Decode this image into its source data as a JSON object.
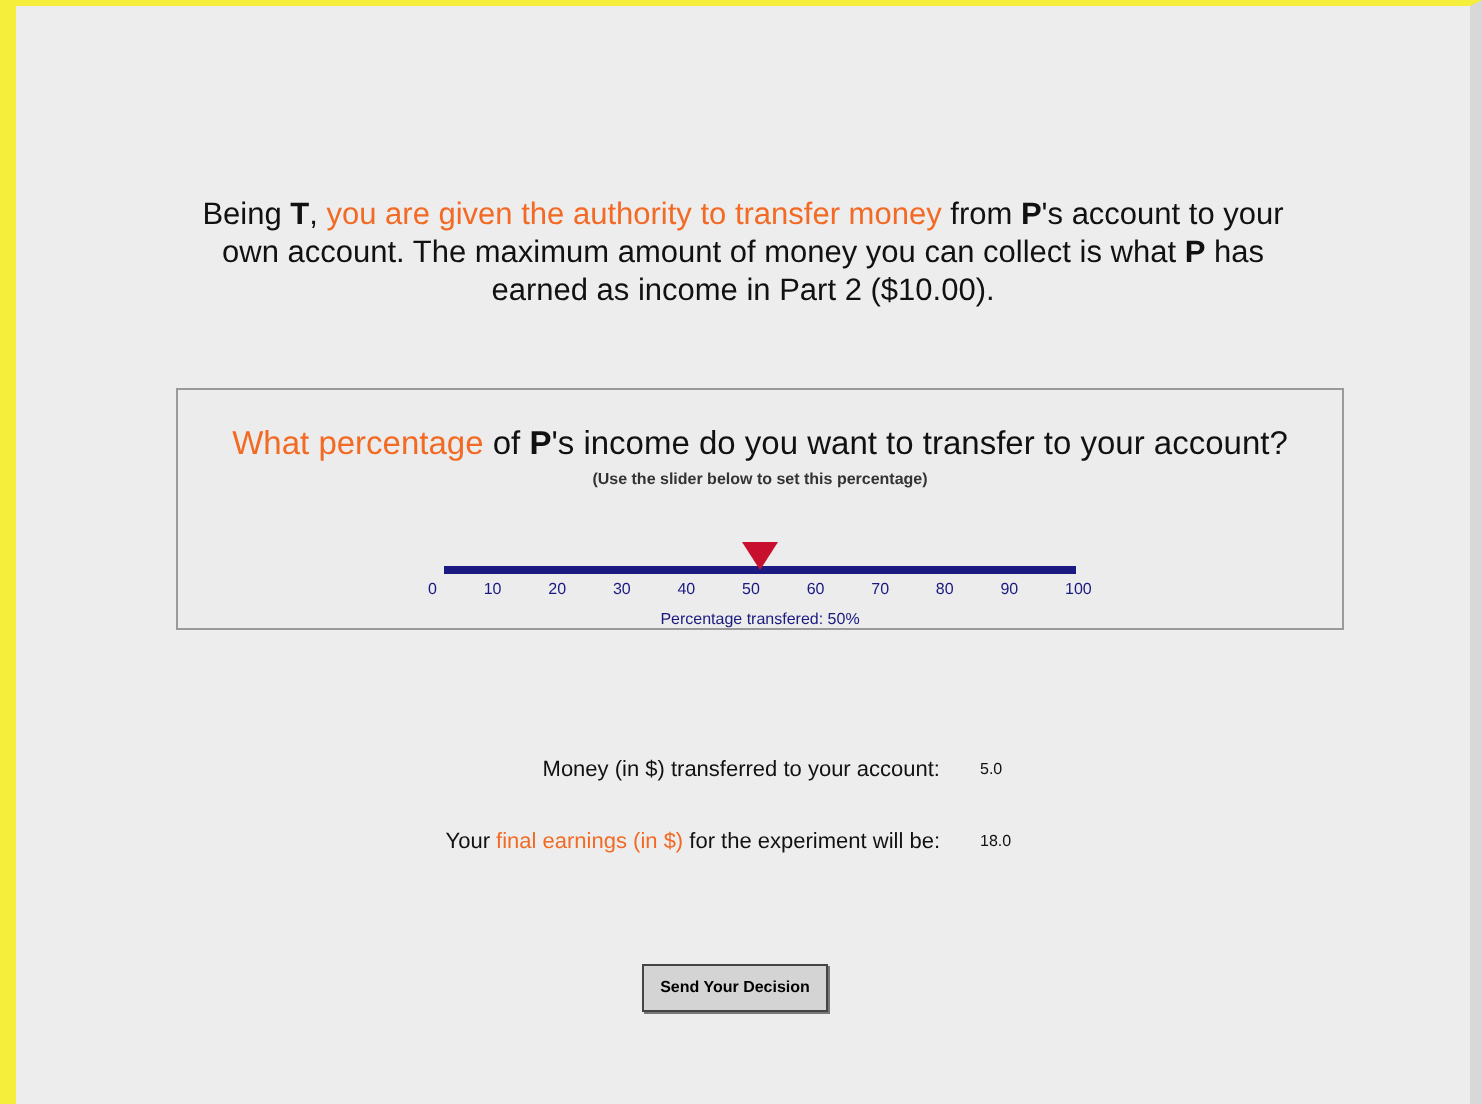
{
  "intro": [
    {
      "text": "Being ",
      "kind": "plain"
    },
    {
      "text": "T",
      "kind": "bold"
    },
    {
      "text": ", ",
      "kind": "plain"
    },
    {
      "text": "you are given the authority to transfer money",
      "kind": "highlight"
    },
    {
      "text": " from ",
      "kind": "plain"
    },
    {
      "text": "P",
      "kind": "bold"
    },
    {
      "text": "'s account to your own account. The maximum amount of money you can collect is what ",
      "kind": "plain"
    },
    {
      "text": "P",
      "kind": "bold"
    },
    {
      "text": " has earned as income in Part 2 ($10.00).",
      "kind": "plain"
    }
  ],
  "question": {
    "title": [
      {
        "text": "What percentage",
        "kind": "highlight"
      },
      {
        "text": " of ",
        "kind": "plain"
      },
      {
        "text": "P",
        "kind": "bold"
      },
      {
        "text": "'s income do you want to transfer to your account?",
        "kind": "plain"
      }
    ],
    "hint": "(Use the slider below to set this percentage)",
    "slider": {
      "level": 0.5,
      "ticks": [
        "0",
        "10",
        "20",
        "30",
        "40",
        "50",
        "60",
        "70",
        "80",
        "90",
        "100"
      ]
    },
    "reading": "Percentage transfered: 50%"
  },
  "results": [
    {
      "label": [
        {
          "text": "Money (in $) transferred to your account:",
          "kind": "plain"
        }
      ],
      "value": "5.0"
    },
    {
      "label": [
        {
          "text": "Your ",
          "kind": "plain"
        },
        {
          "text": "final earnings (in $)",
          "kind": "highlight"
        },
        {
          "text": " for the experiment will be:",
          "kind": "plain"
        }
      ],
      "value": "18.0"
    }
  ],
  "button": "Send Your Decision"
}
